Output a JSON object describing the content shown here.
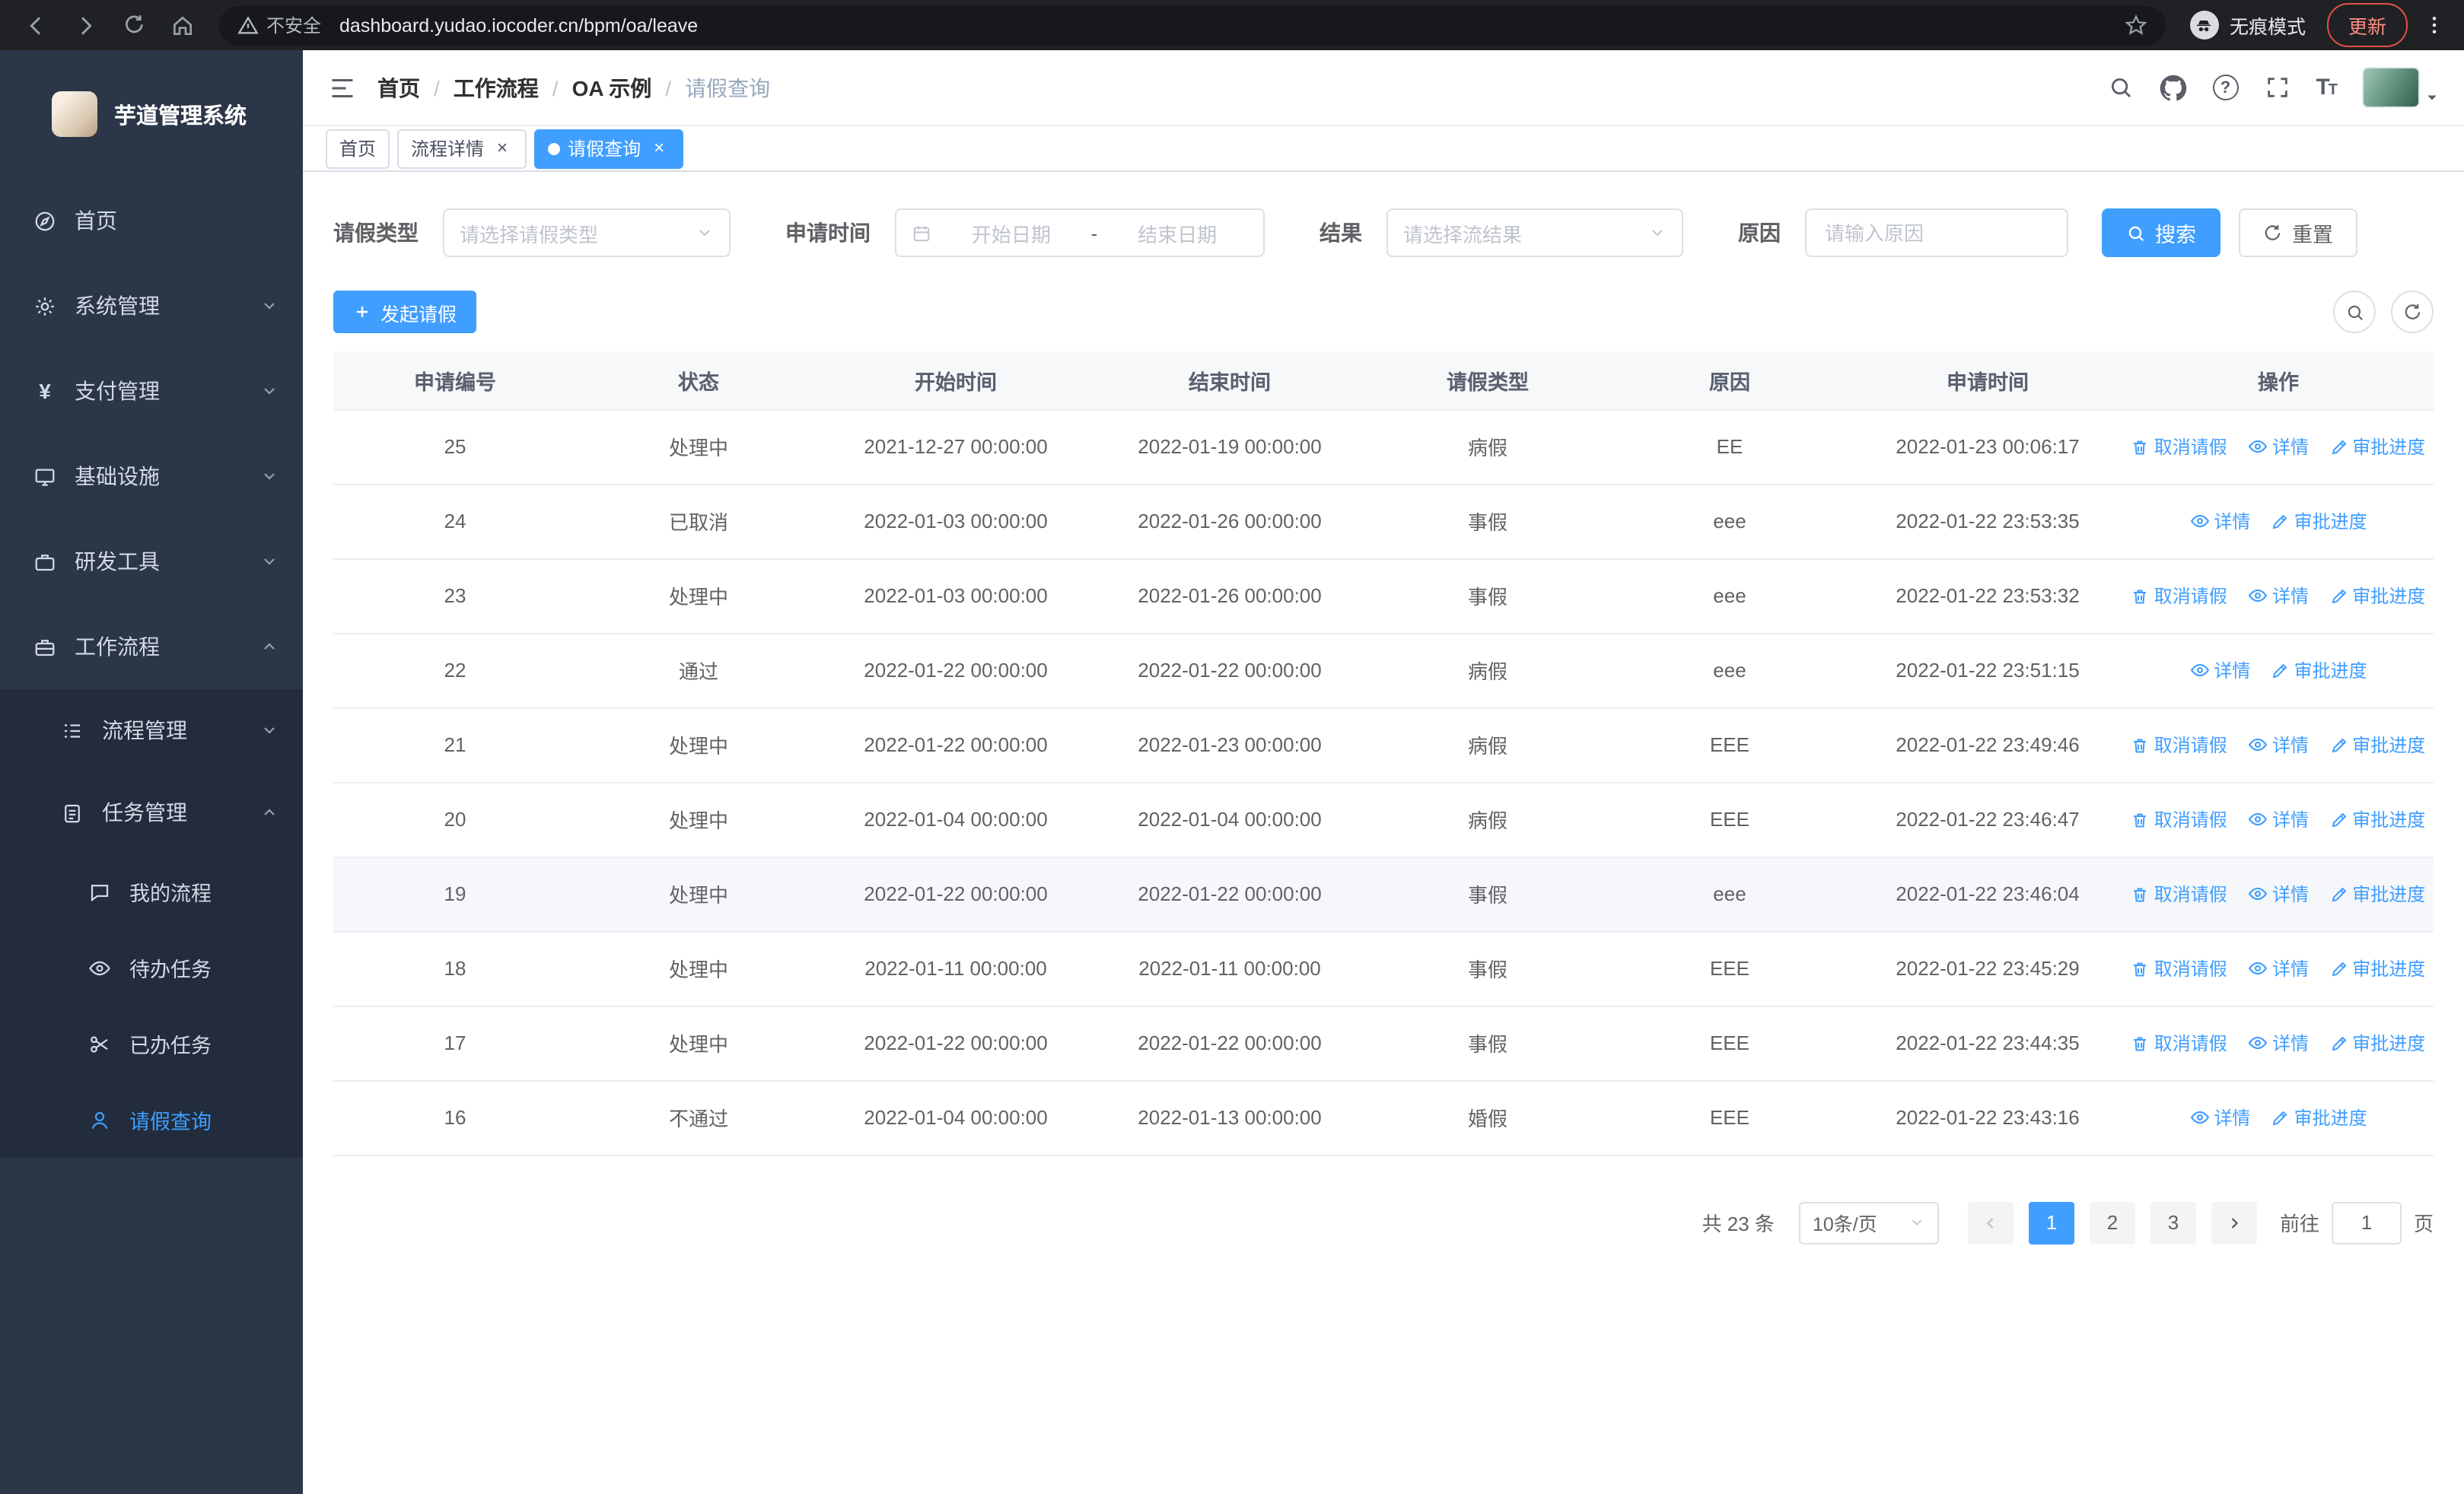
{
  "browser": {
    "security_label": "不安全",
    "url": "dashboard.yudao.iocoder.cn/bpm/oa/leave",
    "incognito_label": "无痕模式",
    "update_button": "更新"
  },
  "sidebar": {
    "logo_title": "芋道管理系统",
    "menu": [
      {
        "label": "首页"
      },
      {
        "label": "系统管理"
      },
      {
        "label": "支付管理"
      },
      {
        "label": "基础设施"
      },
      {
        "label": "研发工具"
      },
      {
        "label": "工作流程"
      }
    ],
    "workflow_children": [
      {
        "label": "流程管理"
      },
      {
        "label": "任务管理"
      }
    ],
    "task_children": [
      {
        "label": "我的流程"
      },
      {
        "label": "待办任务"
      },
      {
        "label": "已办任务"
      },
      {
        "label": "请假查询"
      }
    ]
  },
  "navbar": {
    "breadcrumb": [
      "首页",
      "工作流程",
      "OA 示例",
      "请假查询"
    ]
  },
  "tabs": [
    {
      "label": "首页"
    },
    {
      "label": "流程详情"
    },
    {
      "label": "请假查询"
    }
  ],
  "filters": {
    "leave_type": {
      "label": "请假类型",
      "placeholder": "请选择请假类型"
    },
    "apply_time": {
      "label": "申请时间",
      "start_placeholder": "开始日期",
      "separator": "-",
      "end_placeholder": "结束日期"
    },
    "result": {
      "label": "结果",
      "placeholder": "请选择流结果"
    },
    "reason": {
      "label": "原因",
      "placeholder": "请输入原因"
    },
    "search_button": "搜索",
    "reset_button": "重置"
  },
  "toolbar": {
    "create_button": "发起请假"
  },
  "table": {
    "columns": [
      "申请编号",
      "状态",
      "开始时间",
      "结束时间",
      "请假类型",
      "原因",
      "申请时间",
      "操作"
    ],
    "actions": {
      "cancel": "取消请假",
      "detail": "详情",
      "progress": "审批进度"
    },
    "rows": [
      {
        "id": "25",
        "status": "处理中",
        "start": "2021-12-27 00:00:00",
        "end": "2022-01-19 00:00:00",
        "type": "病假",
        "reason": "EE",
        "applied": "2022-01-23 00:06:17",
        "can_cancel": true,
        "hover": false
      },
      {
        "id": "24",
        "status": "已取消",
        "start": "2022-01-03 00:00:00",
        "end": "2022-01-26 00:00:00",
        "type": "事假",
        "reason": "eee",
        "applied": "2022-01-22 23:53:35",
        "can_cancel": false,
        "hover": false
      },
      {
        "id": "23",
        "status": "处理中",
        "start": "2022-01-03 00:00:00",
        "end": "2022-01-26 00:00:00",
        "type": "事假",
        "reason": "eee",
        "applied": "2022-01-22 23:53:32",
        "can_cancel": true,
        "hover": false
      },
      {
        "id": "22",
        "status": "通过",
        "start": "2022-01-22 00:00:00",
        "end": "2022-01-22 00:00:00",
        "type": "病假",
        "reason": "eee",
        "applied": "2022-01-22 23:51:15",
        "can_cancel": false,
        "hover": false
      },
      {
        "id": "21",
        "status": "处理中",
        "start": "2022-01-22 00:00:00",
        "end": "2022-01-23 00:00:00",
        "type": "病假",
        "reason": "EEE",
        "applied": "2022-01-22 23:49:46",
        "can_cancel": true,
        "hover": false
      },
      {
        "id": "20",
        "status": "处理中",
        "start": "2022-01-04 00:00:00",
        "end": "2022-01-04 00:00:00",
        "type": "病假",
        "reason": "EEE",
        "applied": "2022-01-22 23:46:47",
        "can_cancel": true,
        "hover": false
      },
      {
        "id": "19",
        "status": "处理中",
        "start": "2022-01-22 00:00:00",
        "end": "2022-01-22 00:00:00",
        "type": "事假",
        "reason": "eee",
        "applied": "2022-01-22 23:46:04",
        "can_cancel": true,
        "hover": true
      },
      {
        "id": "18",
        "status": "处理中",
        "start": "2022-01-11 00:00:00",
        "end": "2022-01-11 00:00:00",
        "type": "事假",
        "reason": "EEE",
        "applied": "2022-01-22 23:45:29",
        "can_cancel": true,
        "hover": false
      },
      {
        "id": "17",
        "status": "处理中",
        "start": "2022-01-22 00:00:00",
        "end": "2022-01-22 00:00:00",
        "type": "事假",
        "reason": "EEE",
        "applied": "2022-01-22 23:44:35",
        "can_cancel": true,
        "hover": false
      },
      {
        "id": "16",
        "status": "不通过",
        "start": "2022-01-04 00:00:00",
        "end": "2022-01-13 00:00:00",
        "type": "婚假",
        "reason": "EEE",
        "applied": "2022-01-22 23:43:16",
        "can_cancel": false,
        "hover": false
      }
    ]
  },
  "pagination": {
    "total_text": "共 23 条",
    "page_size_text": "10条/页",
    "pages": [
      "1",
      "2",
      "3"
    ],
    "active_page": "1",
    "goto_prefix": "前往",
    "goto_value": "1",
    "goto_suffix": "页"
  },
  "colors": {
    "primary": "#409eff",
    "sidebar_bg": "#2b3648",
    "link": "#409eff"
  }
}
